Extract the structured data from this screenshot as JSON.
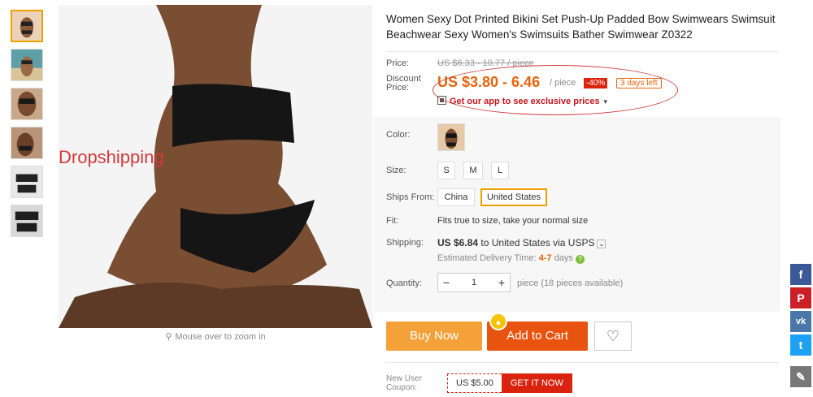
{
  "product": {
    "title": "Women Sexy Dot Printed Bikini Set Push-Up Padded Bow Swimwears Swimsuit Beachwear Sexy Women's Swimsuits Bather Swimwear Z0322",
    "watermark": "Dropshipping",
    "zoom_hint": "Mouse over to zoom in"
  },
  "gallery": {
    "thumbnails": [
      "thumb-1",
      "thumb-2",
      "thumb-3",
      "thumb-4",
      "thumb-5",
      "thumb-6"
    ],
    "active_index": 0
  },
  "price": {
    "label": "Price:",
    "original": "US $6.33 - 10.77 / piece",
    "discount_label_1": "Discount",
    "discount_label_2": "Price:",
    "discount": "US $3.80 - 6.46",
    "per_piece": "/ piece",
    "discount_pct": "-40%",
    "time_left": "3 days left",
    "app_promo": "Get our app to see exclusive prices"
  },
  "options": {
    "color_label": "Color:",
    "size_label": "Size:",
    "sizes": [
      "S",
      "M",
      "L"
    ],
    "ships_from_label": "Ships From:",
    "ships_from": [
      "China",
      "United States"
    ],
    "ships_from_selected": "United States",
    "fit_label": "Fit:",
    "fit_value": "Fits true to size, take your normal size"
  },
  "shipping": {
    "label": "Shipping:",
    "cost": "US $6.84",
    "dest": "to United States via USPS",
    "delivery_label": "Estimated Delivery Time:",
    "delivery_days": "4-7",
    "delivery_unit": "days"
  },
  "quantity": {
    "label": "Quantity:",
    "minus": "−",
    "value": "1",
    "plus": "+",
    "available": "piece (18 pieces available)"
  },
  "actions": {
    "buy_now": "Buy Now",
    "add_to_cart": "Add to Cart",
    "wishlist": "♡"
  },
  "coupon": {
    "label_1": "New User",
    "label_2": "Coupon:",
    "amount": "US $5.00",
    "cta": "GET IT NOW"
  },
  "share": {
    "facebook": "f",
    "pinterest": "P",
    "vk": "vk",
    "twitter": "t",
    "edit": "✎"
  },
  "colors": {
    "accent_orange": "#e8630a",
    "buy_now": "#f5a139",
    "add_to_cart": "#e8540f",
    "sale_red": "#d9230f"
  }
}
